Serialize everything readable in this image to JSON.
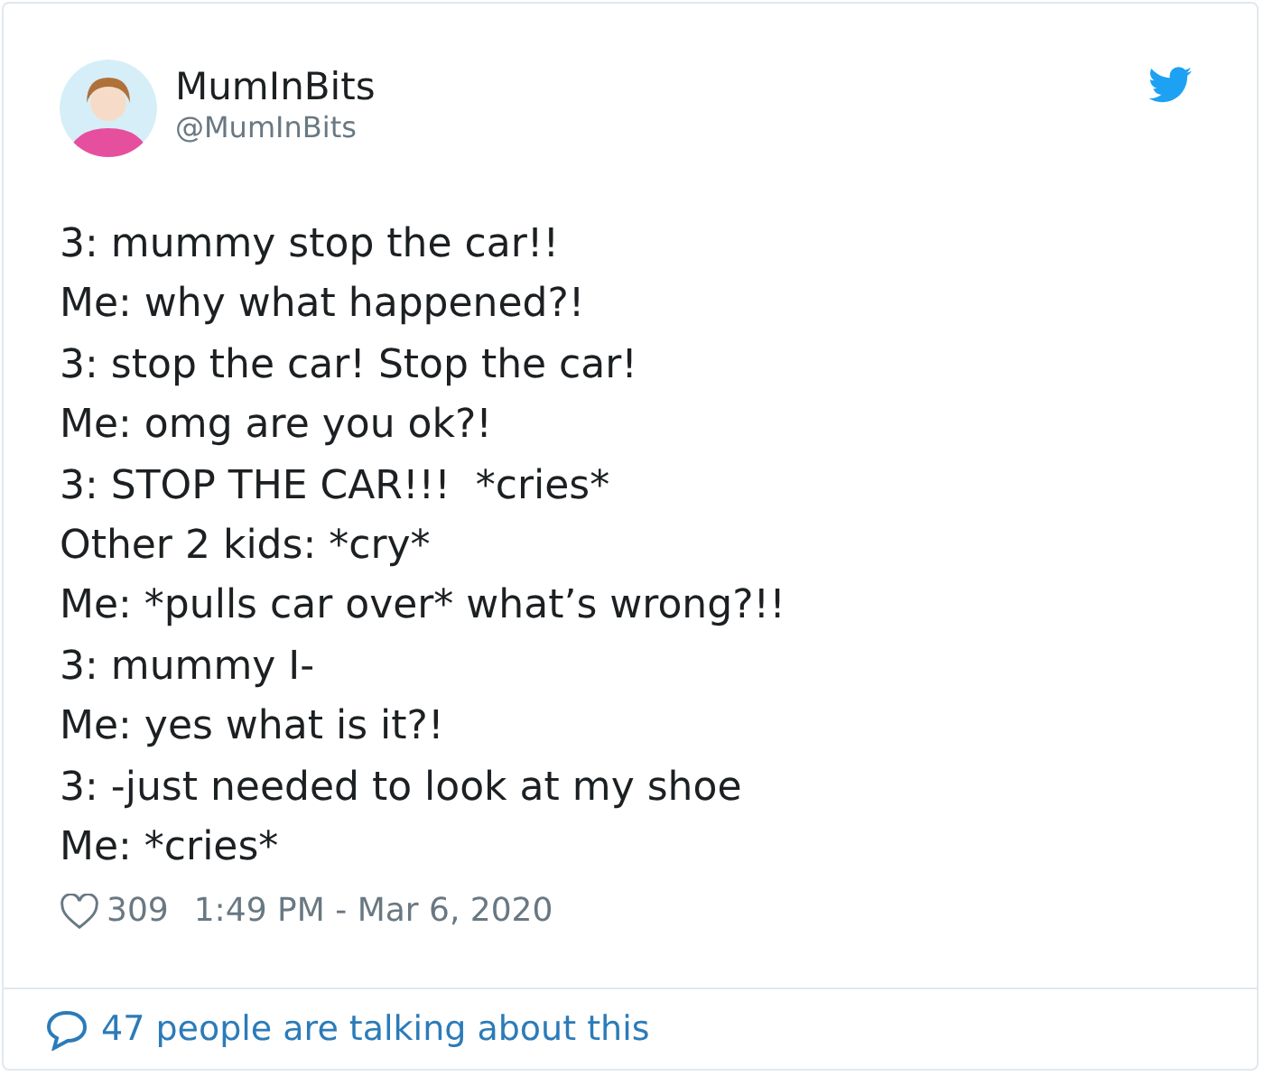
{
  "author": {
    "name": "MumInBits",
    "handle": "@MumInBits"
  },
  "tweet_lines": [
    "3: mummy stop the car!!",
    "Me: why what happened?!",
    "3: stop the car! Stop the car!",
    "Me: omg are you ok?!",
    "3: STOP THE CAR!!!  *cries*",
    "Other 2 kids: *cry*",
    "Me: *pulls car over* what’s wrong?!!",
    "3: mummy I-",
    "Me: yes what is it?!",
    "3: -just needed to look at my shoe",
    "Me: *cries*"
  ],
  "likes": "309",
  "timestamp": "1:49 PM - Mar 6, 2020",
  "conversation_link": "47 people are talking about this"
}
